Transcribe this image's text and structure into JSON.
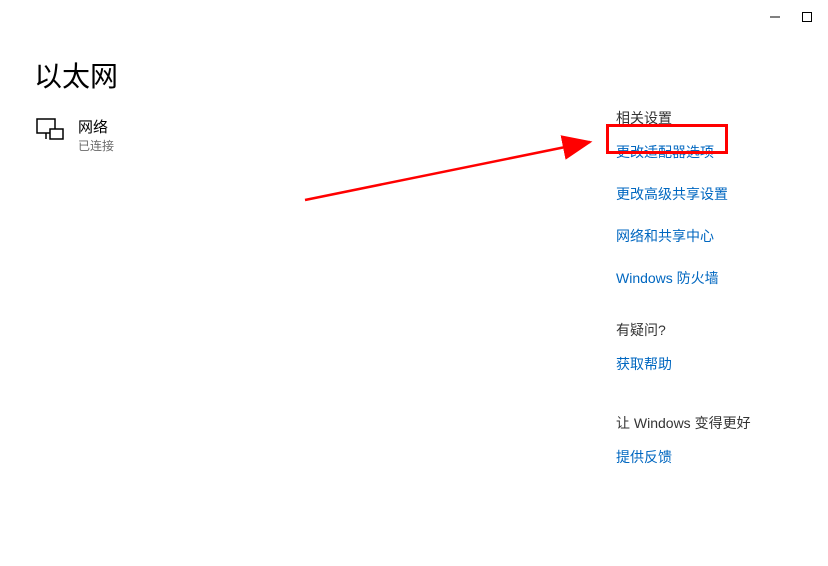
{
  "page": {
    "title": "以太网"
  },
  "network": {
    "name": "网络",
    "status": "已连接"
  },
  "related": {
    "heading": "相关设置",
    "links": {
      "adapter": "更改适配器选项",
      "sharing": "更改高级共享设置",
      "center": "网络和共享中心",
      "firewall": "Windows 防火墙"
    }
  },
  "question": {
    "heading": "有疑问?",
    "help": "获取帮助"
  },
  "feedback": {
    "heading": "让 Windows 变得更好",
    "submit": "提供反馈"
  }
}
